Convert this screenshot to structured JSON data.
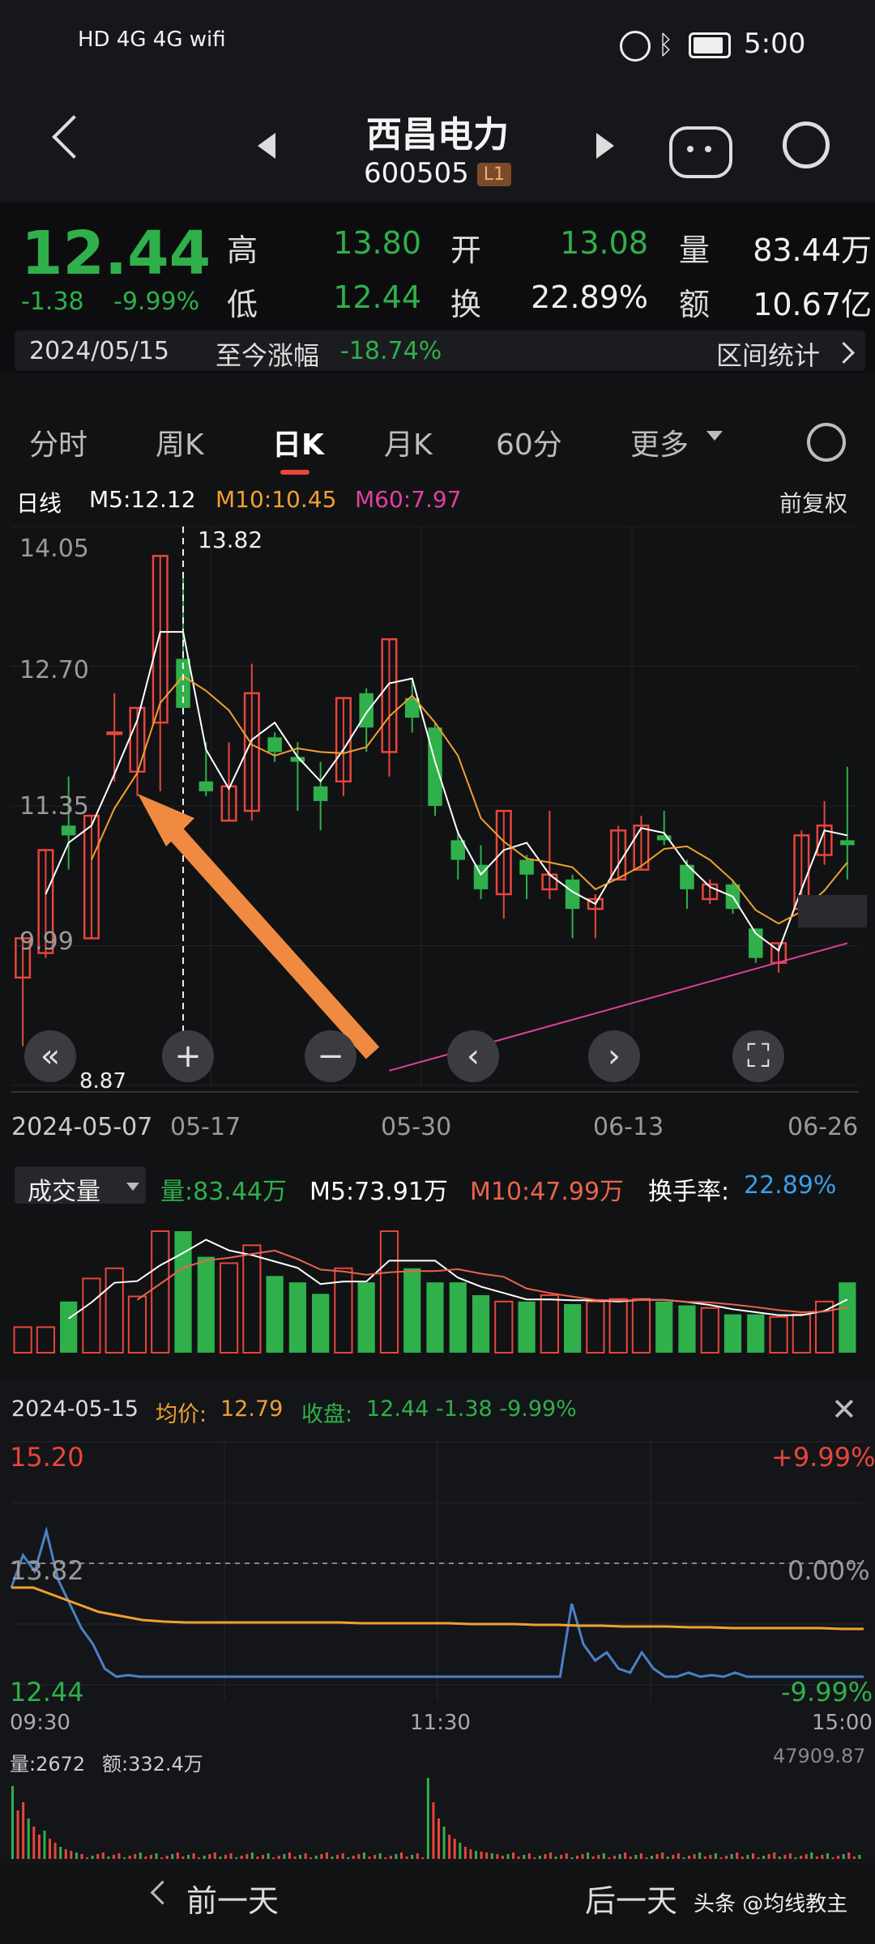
{
  "status": {
    "left_icons": "HD 4G 4G wifi",
    "alarm_icon": "alarm-icon",
    "time": "5:00"
  },
  "header": {
    "name": "西昌电力",
    "code": "600505",
    "level": "L1"
  },
  "quote": {
    "price": "12.44",
    "change": "-1.38",
    "change_pct": "-9.99%",
    "high_label": "高",
    "high": "13.80",
    "open_label": "开",
    "open": "13.08",
    "volume_label": "量",
    "volume": "83.44万",
    "low_label": "低",
    "low": "12.44",
    "turnover_label": "换",
    "turnover": "22.89%",
    "amount_label": "额",
    "amount": "10.67亿",
    "date": "2024/05/15",
    "since_label": "至今涨幅",
    "since_pct": "-18.74%",
    "range_stats": "区间统计"
  },
  "tabs": [
    "分时",
    "周K",
    "日K",
    "月K",
    "60分",
    "更多"
  ],
  "kline": {
    "label": "日线",
    "m5": "M5:12.12",
    "m10": "M10:10.45",
    "m60": "M60:7.97",
    "adjust": "前复权",
    "ylabels": [
      "14.05",
      "12.70",
      "11.35",
      "9.99"
    ],
    "cursor_price": "13.82",
    "low_mark": "8.87",
    "xlabels": [
      "2024-05-07",
      "05-17",
      "05-30",
      "06-13",
      "06-26"
    ]
  },
  "volume": {
    "selector": "成交量",
    "vol": "量:83.44万",
    "m5": "M5:73.91万",
    "m10": "M10:47.99万",
    "turnover_label": "换手率:",
    "turnover": "22.89%"
  },
  "intraday": {
    "date": "2024-05-15",
    "avg_label": "均价:",
    "avg": "12.79",
    "close_label": "收盘:",
    "close": "12.44 -1.38 -9.99%",
    "top_price": "15.20",
    "top_pct": "+9.99%",
    "mid_price": "13.82",
    "mid_pct": "0.00%",
    "bottom_price": "12.44",
    "bottom_pct": "-9.99%",
    "t_open": "09:30",
    "t_mid": "11:30",
    "t_close": "15:00",
    "vol_label": "量:2672",
    "amt_label": "额:332.4万",
    "max_vol": "47909.87"
  },
  "footer": {
    "prev": "前一天",
    "next": "后一天",
    "watermark": "头条 @均线教主"
  },
  "colors": {
    "up": "#e8453c",
    "down": "#2fb04a",
    "m5": "#ffffff",
    "m10": "#f0a030",
    "m60": "#e040a0",
    "avg": "#f0a030",
    "price": "#4a80c8"
  },
  "chart_data": {
    "type": "candlestick",
    "candles": [
      {
        "o": 9.7,
        "c": 10.1,
        "h": 10.1,
        "l": 9.0
      },
      {
        "o": 9.95,
        "c": 11.0,
        "h": 11.0,
        "l": 9.9
      },
      {
        "o": 11.25,
        "c": 11.15,
        "h": 11.75,
        "l": 10.8
      },
      {
        "o": 10.1,
        "c": 11.35,
        "h": 11.35,
        "l": 10.1
      },
      {
        "o": 12.2,
        "c": 12.2,
        "h": 12.6,
        "l": 11.7
      },
      {
        "o": 11.8,
        "c": 12.45,
        "h": 12.45,
        "l": 11.55
      },
      {
        "o": 12.3,
        "c": 14.0,
        "h": 14.0,
        "l": 11.6
      },
      {
        "o": 12.95,
        "c": 12.45,
        "h": 13.8,
        "l": 12.44
      },
      {
        "o": 11.7,
        "c": 11.6,
        "h": 12.1,
        "l": 11.55
      },
      {
        "o": 11.3,
        "c": 11.65,
        "h": 12.1,
        "l": 11.3
      },
      {
        "o": 11.4,
        "c": 12.6,
        "h": 12.9,
        "l": 11.3
      },
      {
        "o": 12.15,
        "c": 12.0,
        "h": 12.2,
        "l": 11.9
      },
      {
        "o": 11.95,
        "c": 11.9,
        "h": 12.1,
        "l": 11.4
      },
      {
        "o": 11.65,
        "c": 11.5,
        "h": 11.9,
        "l": 11.2
      },
      {
        "o": 11.7,
        "c": 12.55,
        "h": 12.55,
        "l": 11.55
      },
      {
        "o": 12.6,
        "c": 12.25,
        "h": 12.65,
        "l": 12.0
      },
      {
        "o": 12.0,
        "c": 13.15,
        "h": 13.15,
        "l": 11.75
      },
      {
        "o": 12.55,
        "c": 12.35,
        "h": 12.75,
        "l": 12.2
      },
      {
        "o": 12.25,
        "c": 11.45,
        "h": 12.3,
        "l": 11.35
      },
      {
        "o": 11.1,
        "c": 10.9,
        "h": 11.2,
        "l": 10.7
      },
      {
        "o": 10.85,
        "c": 10.6,
        "h": 11.05,
        "l": 10.5
      },
      {
        "o": 10.55,
        "c": 11.4,
        "h": 11.4,
        "l": 10.3
      },
      {
        "o": 10.9,
        "c": 10.75,
        "h": 10.95,
        "l": 10.5
      },
      {
        "o": 10.6,
        "c": 10.75,
        "h": 11.4,
        "l": 10.5
      },
      {
        "o": 10.7,
        "c": 10.4,
        "h": 10.75,
        "l": 10.1
      },
      {
        "o": 10.4,
        "c": 10.5,
        "h": 10.55,
        "l": 10.1
      },
      {
        "o": 10.7,
        "c": 11.2,
        "h": 11.25,
        "l": 10.7
      },
      {
        "o": 10.8,
        "c": 11.25,
        "h": 11.35,
        "l": 10.8
      },
      {
        "o": 11.15,
        "c": 11.1,
        "h": 11.4,
        "l": 11.05
      },
      {
        "o": 10.85,
        "c": 10.6,
        "h": 10.9,
        "l": 10.4
      },
      {
        "o": 10.5,
        "c": 10.65,
        "h": 10.7,
        "l": 10.45
      },
      {
        "o": 10.65,
        "c": 10.4,
        "h": 10.7,
        "l": 10.35
      },
      {
        "o": 10.2,
        "c": 9.9,
        "h": 10.2,
        "l": 9.85
      },
      {
        "o": 9.85,
        "c": 10.05,
        "h": 10.05,
        "l": 9.75
      },
      {
        "o": 10.4,
        "c": 11.15,
        "h": 11.2,
        "l": 10.4
      },
      {
        "o": 10.95,
        "c": 11.25,
        "h": 11.5,
        "l": 10.85
      },
      {
        "o": 11.1,
        "c": 11.05,
        "h": 11.85,
        "l": 10.7
      }
    ],
    "ylim": [
      8.6,
      14.3
    ],
    "volumes": [
      20,
      20,
      40,
      58,
      66,
      44,
      95,
      95,
      75,
      70,
      84,
      60,
      55,
      46,
      66,
      55,
      95,
      66,
      55,
      55,
      45,
      40,
      40,
      45,
      38,
      40,
      42,
      42,
      40,
      37,
      35,
      30,
      30,
      28,
      30,
      40,
      55
    ]
  }
}
